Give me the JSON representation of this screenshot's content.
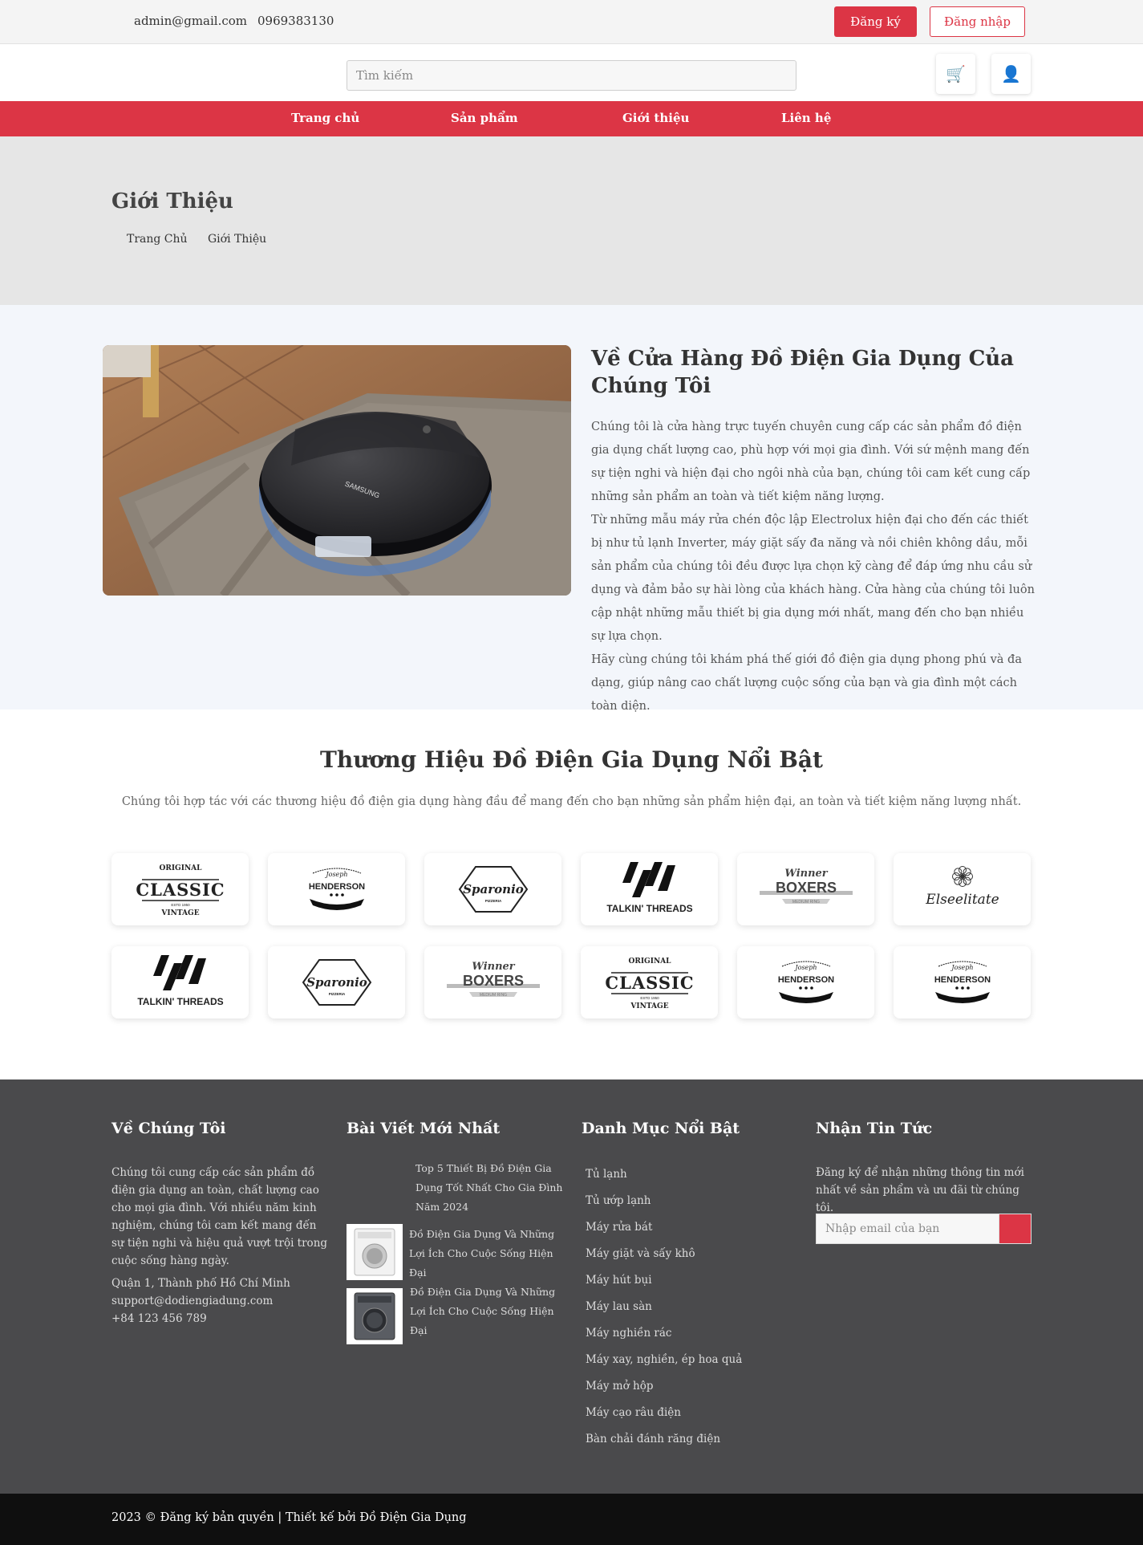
{
  "topbar": {
    "email": "admin@gmail.com",
    "phone": "0969383130",
    "register_label": "Đăng ký",
    "login_label": "Đăng nhập"
  },
  "search": {
    "placeholder": "Tìm kiếm"
  },
  "header_icons": [
    "cart-icon",
    "user-icon"
  ],
  "nav": [
    {
      "label": "Trang chủ"
    },
    {
      "label": "Sản phẩm"
    },
    {
      "label": "Giới thiệu"
    },
    {
      "label": "Liên hệ"
    }
  ],
  "page_header": {
    "title": "Giới Thiệu",
    "breadcrumb": [
      "Trang Chủ",
      "Giới Thiệu"
    ]
  },
  "about": {
    "image_label": "SAMSUNG",
    "heading": "Về Cửa Hàng Đồ Điện Gia Dụng Của Chúng Tôi",
    "paragraphs": [
      "Chúng tôi là cửa hàng trực tuyến chuyên cung cấp các sản phẩm đồ điện gia dụng chất lượng cao, phù hợp với mọi gia đình. Với sứ mệnh mang đến sự tiện nghi và hiện đại cho ngôi nhà của bạn, chúng tôi cam kết cung cấp những sản phẩm an toàn và tiết kiệm năng lượng.",
      "Từ những mẫu máy rửa chén độc lập Electrolux hiện đại cho đến các thiết bị như tủ lạnh Inverter, máy giặt sấy đa năng và nồi chiên không dầu, mỗi sản phẩm của chúng tôi đều được lựa chọn kỹ càng để đáp ứng nhu cầu sử dụng và đảm bảo sự hài lòng của khách hàng. Cửa hàng của chúng tôi luôn cập nhật những mẫu thiết bị gia dụng mới nhất, mang đến cho bạn nhiều sự lựa chọn.",
      "Hãy cùng chúng tôi khám phá thế giới đồ điện gia dụng phong phú và đa dạng, giúp nâng cao chất lượng cuộc sống của bạn và gia đình một cách toàn diện."
    ]
  },
  "brands": {
    "title": "Thương Hiệu Đồ Điện Gia Dụng Nổi Bật",
    "subtitle": "Chúng tôi hợp tác với các thương hiệu đồ điện gia dụng hàng đầu để mang đến cho bạn những sản phẩm hiện đại, an toàn và tiết kiệm năng lượng nhất.",
    "logos": [
      {
        "kind": "classic",
        "top": "ORIGINAL",
        "main": "CLASSIC",
        "year": "ESTD 1950",
        "bottom": "VINTAGE"
      },
      {
        "kind": "henderson",
        "script": "Joseph",
        "main": "HENDERSON"
      },
      {
        "kind": "sparonio",
        "main": "Sparonio",
        "sub": "PIZZERIA"
      },
      {
        "kind": "talkin",
        "main": "TALKIN' THREADS"
      },
      {
        "kind": "boxers",
        "script": "Winner",
        "main": "BOXERS",
        "sub": "MEDIUM RING"
      },
      {
        "kind": "else",
        "main": "Elseelitate"
      },
      {
        "kind": "talkin",
        "main": "TALKIN' THREADS"
      },
      {
        "kind": "sparonio",
        "main": "Sparonio",
        "sub": "PIZZERIA"
      },
      {
        "kind": "boxers",
        "script": "Winner",
        "main": "BOXERS",
        "sub": "MEDIUM RING"
      },
      {
        "kind": "classic",
        "top": "ORIGINAL",
        "main": "CLASSIC",
        "year": "ESTD 1950",
        "bottom": "VINTAGE"
      },
      {
        "kind": "henderson",
        "script": "Joseph",
        "main": "HENDERSON"
      },
      {
        "kind": "henderson",
        "script": "Joseph",
        "main": "HENDERSON"
      }
    ]
  },
  "footer": {
    "about_title": "Về Chúng Tôi",
    "about_text": "Chúng tôi cung cấp các sản phẩm đồ điện gia dụng an toàn, chất lượng cao cho mọi gia đình. Với nhiều năm kinh nghiệm, chúng tôi cam kết mang đến sự tiện nghi và hiệu quả vượt trội trong cuộc sống hàng ngày.",
    "address": "Quận 1, Thành phố Hồ Chí Minh",
    "email": "support@dodiengiadung.com",
    "phone": "+84 123 456 789",
    "posts_title": "Bài Viết Mới Nhất",
    "posts": [
      {
        "title": "Top 5 Thiết Bị Đồ Điện Gia Dụng Tốt Nhất Cho Gia Đình Năm 2024"
      },
      {
        "title": "Đồ Điện Gia Dụng Và Những Lợi Ích Cho Cuộc Sống Hiện Đại"
      },
      {
        "title": "Đồ Điện Gia Dụng Và Những Lợi Ích Cho Cuộc Sống Hiện Đại"
      }
    ],
    "categories_title": "Danh Mục Nổi Bật",
    "categories": [
      "Tủ lạnh",
      "Tủ ướp lạnh",
      "Máy rửa bát",
      "Máy giặt và sấy khô",
      "Máy hút bụi",
      "Máy lau sàn",
      "Máy nghiền rác",
      "Máy xay, nghiền, ép hoa quả",
      "Máy mở hộp",
      "Máy cạo râu điện",
      "Bàn chải đánh răng điện"
    ],
    "newsletter_title": "Nhận Tin Tức",
    "newsletter_text": "Đăng ký để nhận những thông tin mới nhất về sản phẩm và ưu đãi từ chúng tôi.",
    "newsletter_placeholder": "Nhập email của bạn",
    "copyright": "2023 © Đăng ký bản quyền | Thiết kế bởi Đồ Điện Gia Dụng"
  }
}
